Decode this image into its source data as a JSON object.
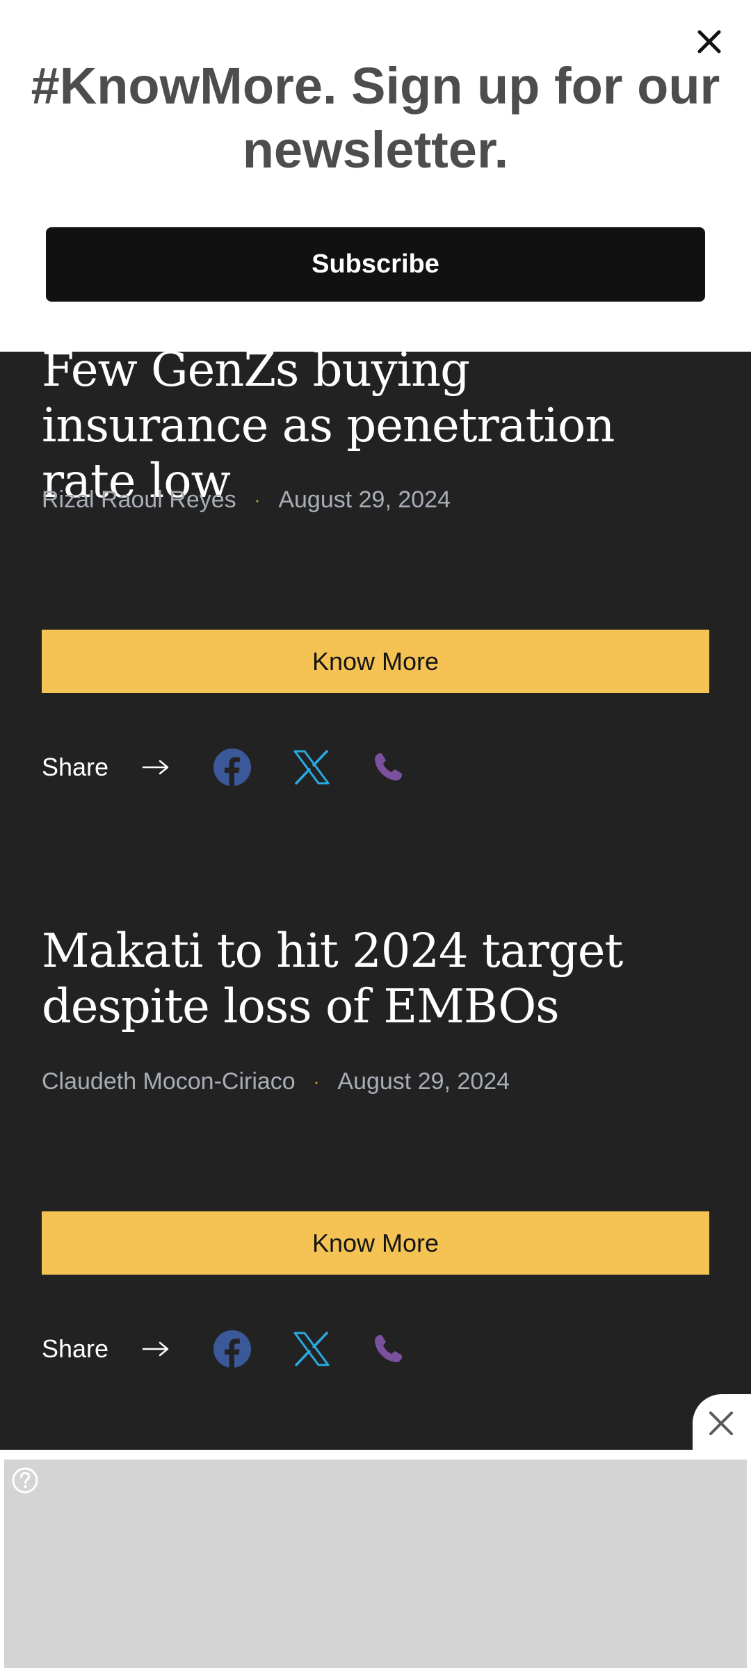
{
  "newsletter": {
    "title": "#KnowMore. Sign up for our newsletter.",
    "subscribe_label": "Subscribe",
    "close_icon": "close-icon"
  },
  "articles": [
    {
      "title": "Few GenZs buying insurance as penetration rate low",
      "author": "Rizal Raoul Reyes",
      "separator": "·",
      "date": "August 29, 2024",
      "cta": "Know More",
      "share_label": "Share"
    },
    {
      "title": "Makati to hit 2024 target despite loss of EMBOs",
      "author": "Claudeth Mocon-Ciriaco",
      "separator": "·",
      "date": "August 29, 2024",
      "cta": "Know More",
      "share_label": "Share"
    }
  ],
  "share_icons": [
    "facebook-icon",
    "x-icon",
    "viber-phone-icon"
  ],
  "colors": {
    "background": "#222223",
    "accent_button": "#f5c354",
    "facebook": "#3b5998",
    "x": "#2aa9e0",
    "viber": "#7b519d",
    "subscribe_button": "#111111"
  },
  "ad": {
    "help_icon": "question-icon",
    "close_icon": "close-icon"
  }
}
